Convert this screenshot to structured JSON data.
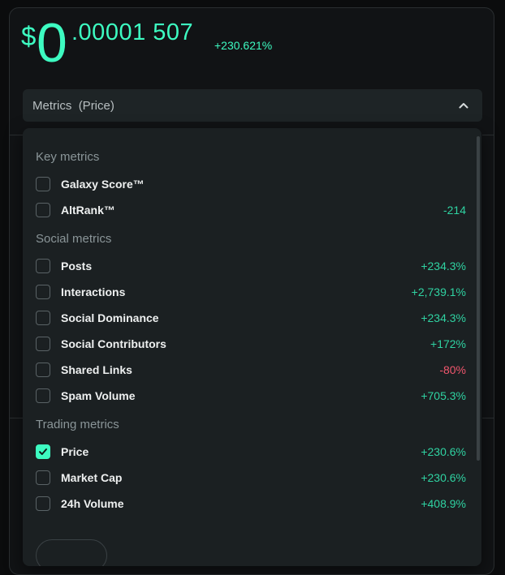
{
  "price": {
    "symbol": "$",
    "integer": "0",
    "decimal": ".00001 507",
    "change": "+230.621%"
  },
  "selector": {
    "label": "Metrics",
    "sub": "(Price)"
  },
  "sections": [
    {
      "title": "Key metrics",
      "items": [
        {
          "label": "Galaxy Score™",
          "value": "",
          "checked": false
        },
        {
          "label": "AltRank™",
          "value": "-214",
          "checked": false
        }
      ]
    },
    {
      "title": "Social metrics",
      "items": [
        {
          "label": "Posts",
          "value": "+234.3%",
          "checked": false
        },
        {
          "label": "Interactions",
          "value": "+2,739.1%",
          "checked": false
        },
        {
          "label": "Social Dominance",
          "value": "+234.3%",
          "checked": false
        },
        {
          "label": "Social Contributors",
          "value": "+172%",
          "checked": false
        },
        {
          "label": "Shared Links",
          "value": "-80%",
          "checked": false,
          "negative": true
        },
        {
          "label": "Spam Volume",
          "value": "+705.3%",
          "checked": false
        }
      ]
    },
    {
      "title": "Trading metrics",
      "items": [
        {
          "label": "Price",
          "value": "+230.6%",
          "checked": true
        },
        {
          "label": "Market Cap",
          "value": "+230.6%",
          "checked": false
        },
        {
          "label": "24h Volume",
          "value": "+408.9%",
          "checked": false
        }
      ]
    }
  ],
  "colors": {
    "accent": "#3dfbc1",
    "positive": "#2fd3a2",
    "negative": "#f0566d"
  }
}
